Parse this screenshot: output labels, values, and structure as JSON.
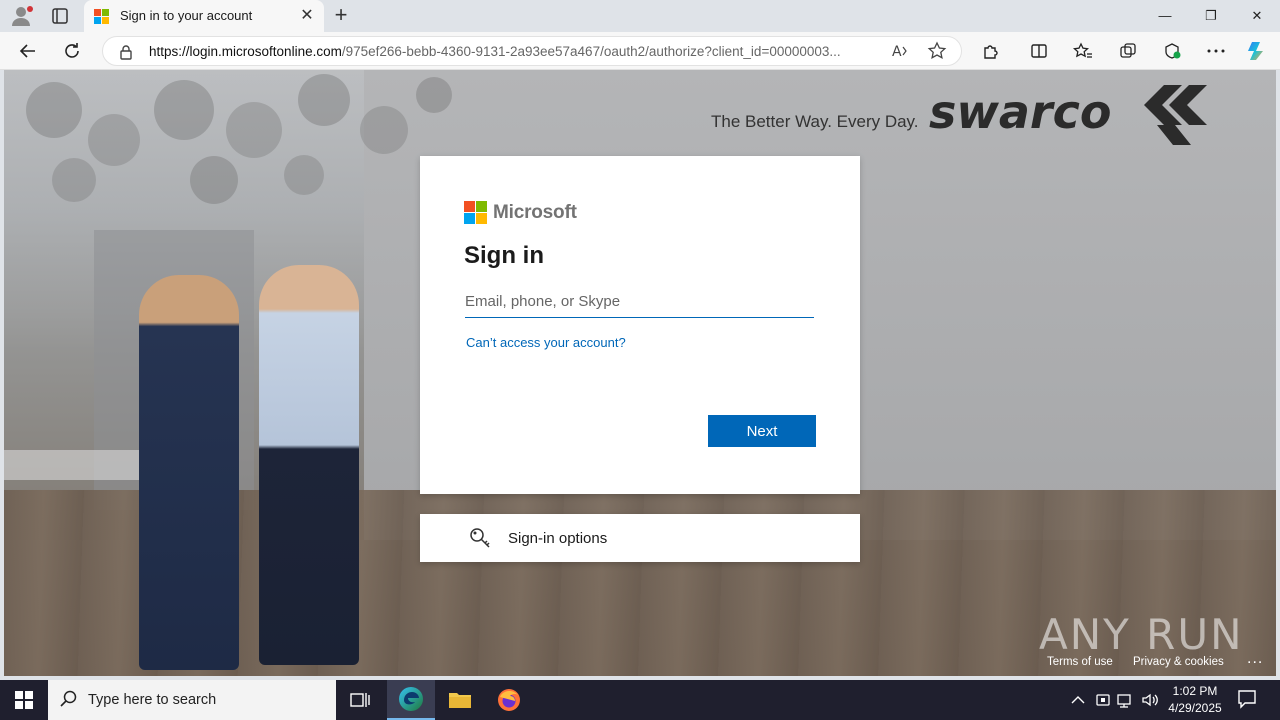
{
  "browser": {
    "tab": {
      "title": "Sign in to your account"
    },
    "url": {
      "domain": "https://login.microsoftonline.com",
      "path": "/975ef266-bebb-4360-9131-2a93ee57a467/oauth2/authorize?client_id=00000003..."
    }
  },
  "page": {
    "brand": {
      "tagline": "The Better Way. Every Day."
    },
    "card": {
      "logo_text": "Microsoft",
      "heading": "Sign in",
      "email_placeholder": "Email, phone, or Skype",
      "cant_access_link": "Can’t access your account?",
      "next_button": "Next"
    },
    "signin_options": {
      "label": "Sign-in options"
    },
    "footer": {
      "terms": "Terms of use",
      "privacy": "Privacy & cookies",
      "more": "..."
    },
    "watermark": "ANY RUN"
  },
  "taskbar": {
    "search_placeholder": "Type here to search",
    "time": "1:02 PM",
    "date": "4/29/2025"
  },
  "colors": {
    "accent": "#0067b8",
    "ms_red": "#f25022",
    "ms_green": "#7fba00",
    "ms_blue": "#00a4ef",
    "ms_yellow": "#ffb900"
  }
}
